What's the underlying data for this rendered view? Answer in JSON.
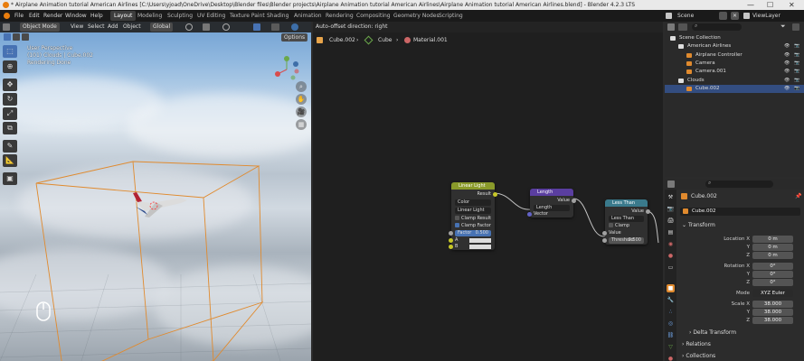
{
  "titlebar": {
    "title": "* Airplane Animation tutorial American Airlines [C:\\Users\\yjoad\\OneDrive\\Desktop\\Blender files\\Blender projects\\Airplane Animation tutorial American Airlines\\Airplane Animation tutorial American Airlines.blend] - Blender 4.2.3 LTS",
    "minimize": "—",
    "maximize": "☐",
    "close": "✕"
  },
  "menus": [
    "File",
    "Edit",
    "Render",
    "Window",
    "Help"
  ],
  "workspaces": [
    "Layout",
    "Modeling",
    "Sculpting",
    "UV Editing",
    "Texture Paint",
    "Shading",
    "Animation",
    "Rendering",
    "Compositing",
    "Geometry Nodes",
    "Scripting"
  ],
  "workspace_active": "Layout",
  "scene": {
    "label": "Scene",
    "view_layer": "ViewLayer"
  },
  "viewport": {
    "mode": "Object Mode",
    "menus": [
      "View",
      "Select",
      "Add",
      "Object"
    ],
    "orientation": "Global",
    "options": "Options",
    "info": [
      "User Perspective",
      "(101) Clouds | Cube.002",
      "Rendering Done"
    ]
  },
  "node_editor": {
    "status": "Auto-offset direction: right",
    "breadcrumb": [
      "Cube.002",
      "Cube",
      "Material.001"
    ],
    "nodes": {
      "linear_light": {
        "title": "Linear Light",
        "output": "Result",
        "dropdown1": "Color",
        "dropdown2": "Linear Light",
        "check1": "Clamp Result",
        "check2": "Clamp Factor",
        "factor_label": "Factor",
        "factor_value": "0.500",
        "input_a": "A",
        "input_b": "B"
      },
      "length": {
        "title": "Length",
        "output": "Value",
        "dropdown": "Length",
        "input": "Vector"
      },
      "less_than": {
        "title": "Less Than",
        "output": "Value",
        "dropdown": "Less Than",
        "check": "Clamp",
        "input": "Value",
        "threshold_label": "Threshold",
        "threshold_value": "0.500"
      }
    }
  },
  "outliner": {
    "search_placeholder": "",
    "rows": [
      {
        "label": "Scene Collection",
        "indent": 0
      },
      {
        "label": "American Airlines",
        "indent": 1
      },
      {
        "label": "Airplane Controller",
        "indent": 2
      },
      {
        "label": "Camera",
        "indent": 2
      },
      {
        "label": "Camera.001",
        "indent": 2
      },
      {
        "label": "Clouds",
        "indent": 1
      },
      {
        "label": "Cube.002",
        "indent": 2,
        "selected": true
      }
    ]
  },
  "properties": {
    "object_name": "Cube.002",
    "object_field": "Cube.002",
    "transform_label": "Transform",
    "location_label": "Location X",
    "location": [
      "0 m",
      "0 m",
      "0 m"
    ],
    "rotation_label": "Rotation X",
    "rotation": [
      "0°",
      "0°",
      "0°"
    ],
    "mode_label": "Mode",
    "mode_value": "XYZ Euler",
    "scale_label": "Scale X",
    "scale": [
      "38.000",
      "38.000",
      "38.000"
    ],
    "axis_y": "Y",
    "axis_z": "Z",
    "delta_transform": "Delta Transform",
    "relations": "Relations",
    "collections": "Collections"
  },
  "colors": {
    "accent": "#4772b3",
    "selection": "#334d80",
    "converter_header": "#3a7a8c",
    "vector_math_header": "#5a3ea0",
    "mix_header": "#8a9a2a",
    "cube_bounds": "#e08a2e"
  }
}
